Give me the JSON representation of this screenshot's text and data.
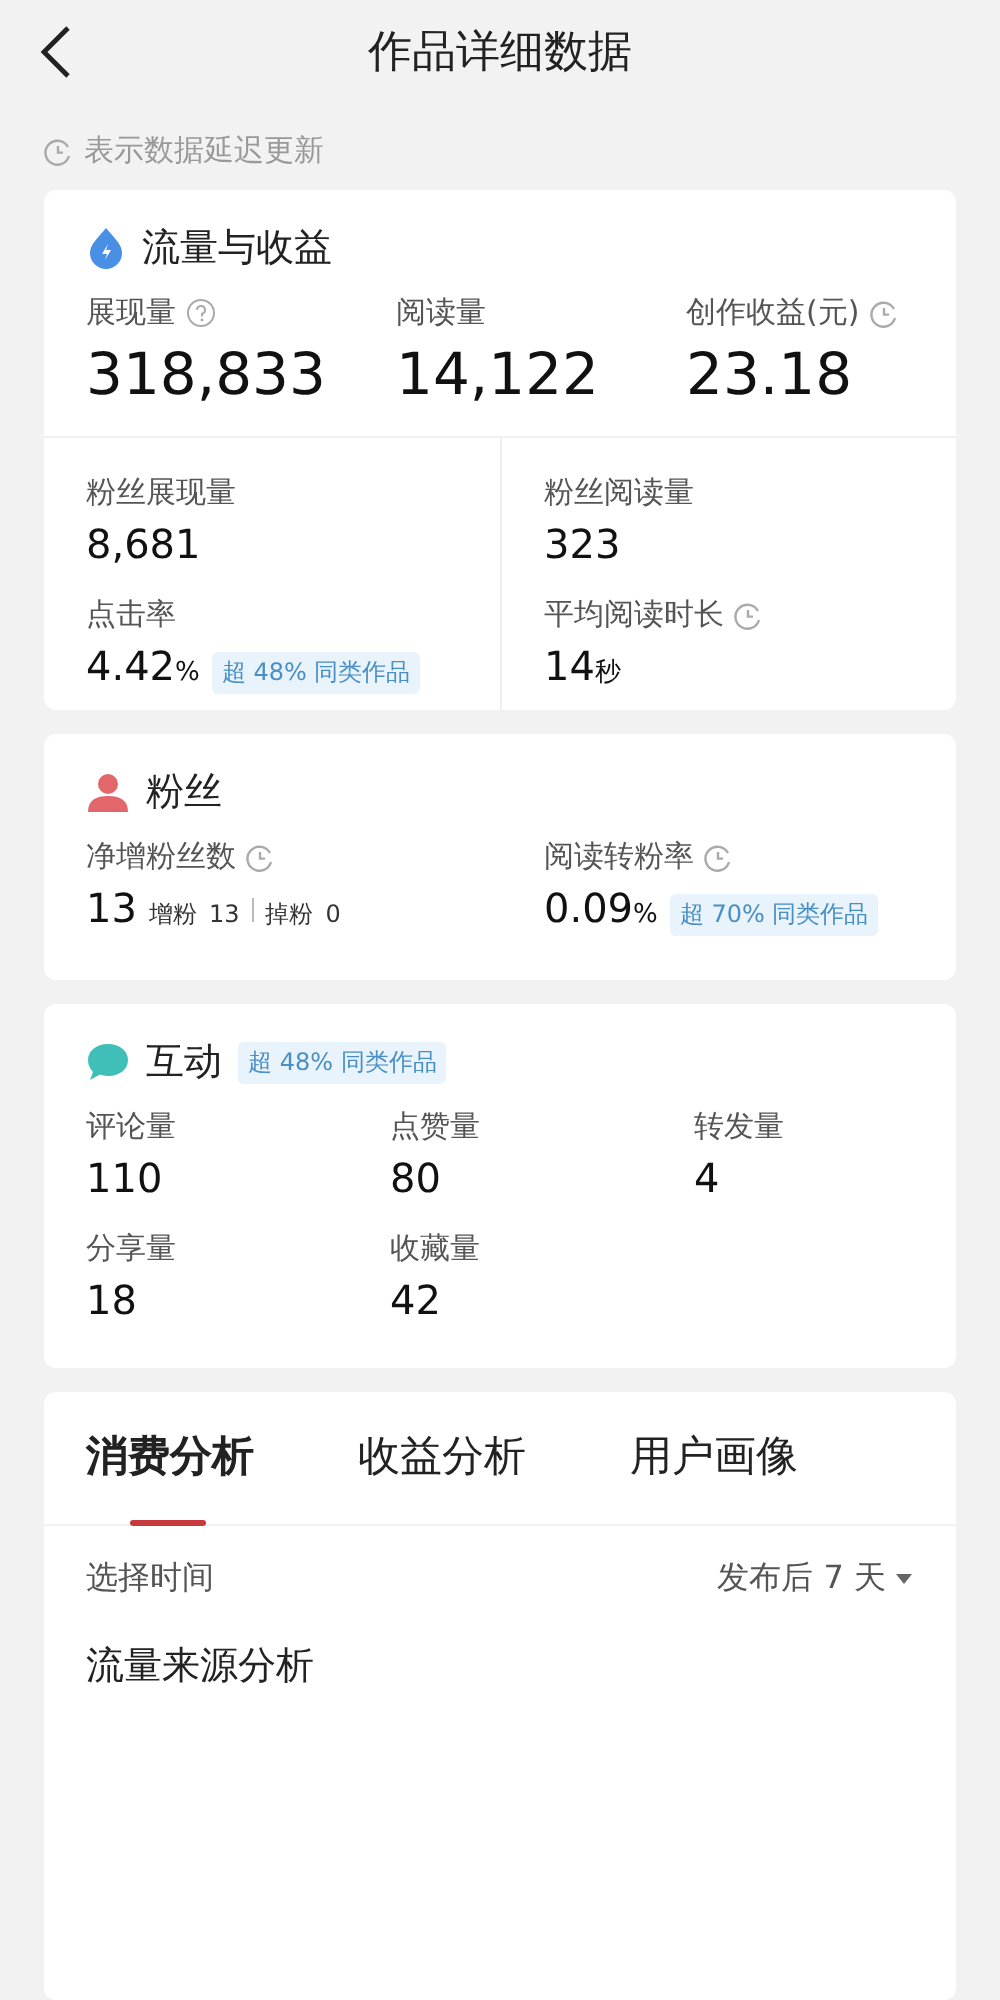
{
  "header": {
    "title": "作品详细数据"
  },
  "note": {
    "text": "表示数据延迟更新"
  },
  "traffic": {
    "title": "流量与收益",
    "kind": "drop",
    "main": [
      {
        "label": "展现量",
        "value": "318,833",
        "help": true
      },
      {
        "label": "阅读量",
        "value": "14,122"
      },
      {
        "label": "创作收益(元)",
        "value": "23.18",
        "delayed": true
      }
    ],
    "details": [
      {
        "label": "粉丝展现量",
        "value": "8,681"
      },
      {
        "label": "粉丝阅读量",
        "value": "323"
      },
      {
        "label": "点击率",
        "value": "4.42",
        "unit": "%",
        "badge": "超 48% 同类作品"
      },
      {
        "label": "平均阅读时长",
        "value": "14",
        "unit": "秒",
        "delayed": true
      }
    ]
  },
  "fans": {
    "title": "粉丝",
    "kind": "person",
    "metrics": [
      {
        "label": "净增粉丝数",
        "value": "13",
        "delayed": true,
        "breakdown": [
          {
            "label": "增粉",
            "value": "13"
          },
          {
            "label": "掉粉",
            "value": "0"
          }
        ]
      },
      {
        "label": "阅读转粉率",
        "value": "0.09",
        "unit": "%",
        "delayed": true,
        "badge": "超 70% 同类作品"
      }
    ]
  },
  "interaction": {
    "title": "互动",
    "kind": "chat",
    "badge": "超 48% 同类作品",
    "metrics": [
      {
        "label": "评论量",
        "value": "110"
      },
      {
        "label": "点赞量",
        "value": "80"
      },
      {
        "label": "转发量",
        "value": "4"
      },
      {
        "label": "分享量",
        "value": "18"
      },
      {
        "label": "收藏量",
        "value": "42"
      }
    ]
  },
  "analysis": {
    "tabs": [
      {
        "label": "消费分析",
        "selected": true
      },
      {
        "label": "收益分析",
        "selected": false
      },
      {
        "label": "用户画像",
        "selected": false
      }
    ],
    "time_label": "选择时间",
    "time_value": "发布后 7 天",
    "section_title": "流量来源分析"
  }
}
